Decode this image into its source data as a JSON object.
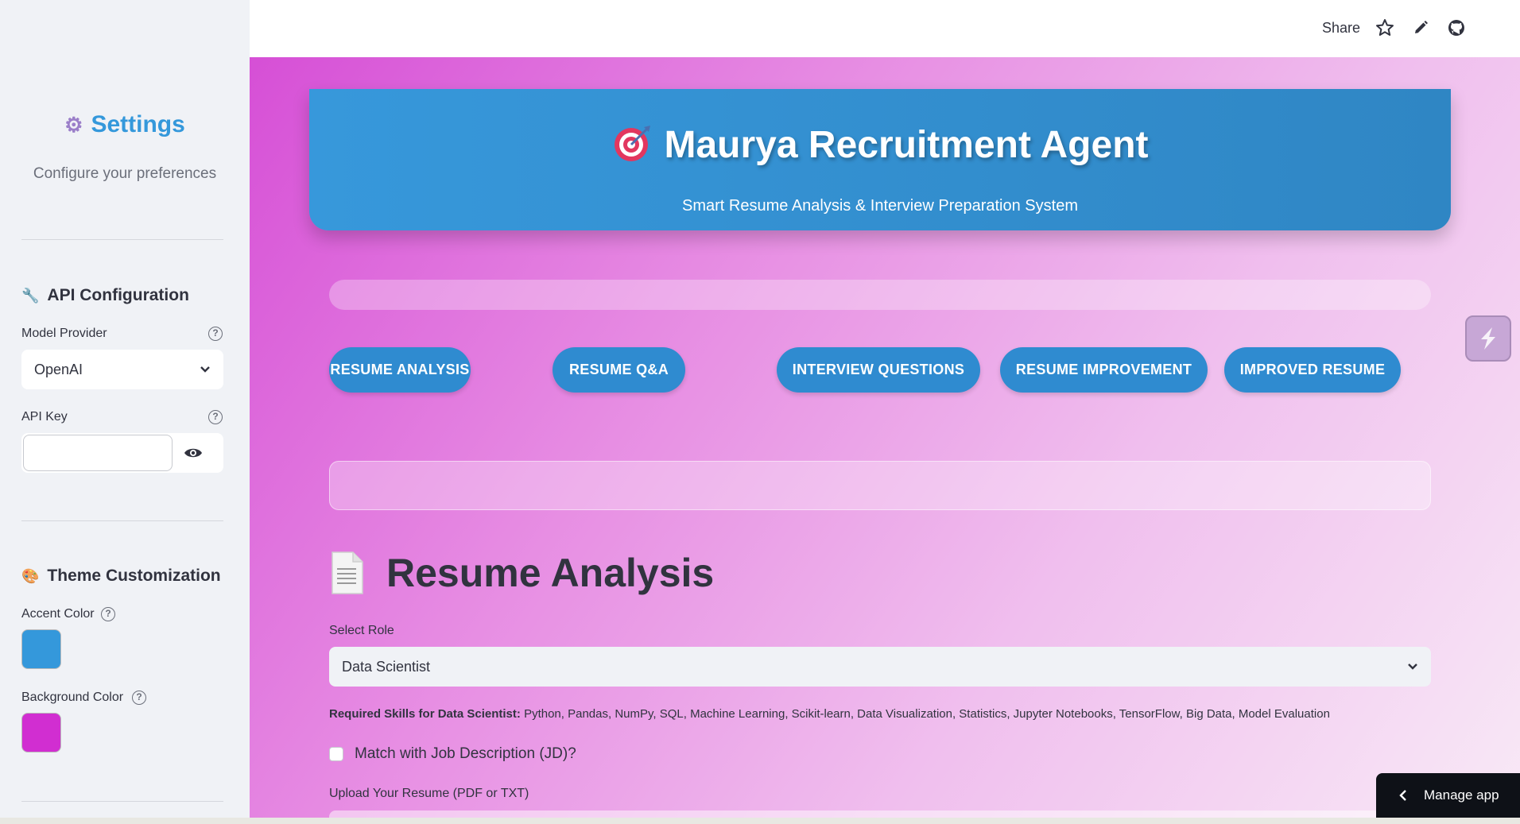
{
  "sidebar": {
    "title": "Settings",
    "subtitle": "Configure your preferences",
    "api_section": {
      "heading": "API Configuration",
      "model_label": "Model Provider",
      "model_value": "OpenAI",
      "api_key_label": "API Key",
      "api_key_value": ""
    },
    "theme_section": {
      "heading": "Theme Customization",
      "accent_label": "Accent Color",
      "accent_color": "#3498db",
      "background_label": "Background Color",
      "background_color": "#d12ed1"
    }
  },
  "topbar": {
    "share_label": "Share",
    "icons": [
      "star-icon",
      "pencil-icon",
      "github-icon"
    ]
  },
  "hero": {
    "title": "Maurya Recruitment Agent",
    "subtitle": "Smart Resume Analysis & Interview Preparation System"
  },
  "tabs": [
    {
      "label": "RESUME ANALYSIS"
    },
    {
      "label": "RESUME Q&A"
    },
    {
      "label": "INTERVIEW QUESTIONS"
    },
    {
      "label": "RESUME IMPROVEMENT"
    },
    {
      "label": "IMPROVED RESUME"
    }
  ],
  "analysis": {
    "title": "Resume Analysis",
    "role_label": "Select Role",
    "role_value": "Data Scientist",
    "skills_prefix": "Required Skills for Data Scientist:",
    "skills_list": "Python, Pandas, NumPy, SQL, Machine Learning, Scikit-learn, Data Visualization, Statistics, Jupyter Notebooks, TensorFlow, Big Data, Model Evaluation",
    "jd_checkbox_label": "Match with Job Description (JD)?",
    "upload_label": "Upload Your Resume (PDF or TXT)"
  },
  "manage_app_label": "Manage app",
  "colors": {
    "accent": "#3498db",
    "tab_bg": "#2f8bd0",
    "sidebar_bg": "#f0f2f6"
  }
}
